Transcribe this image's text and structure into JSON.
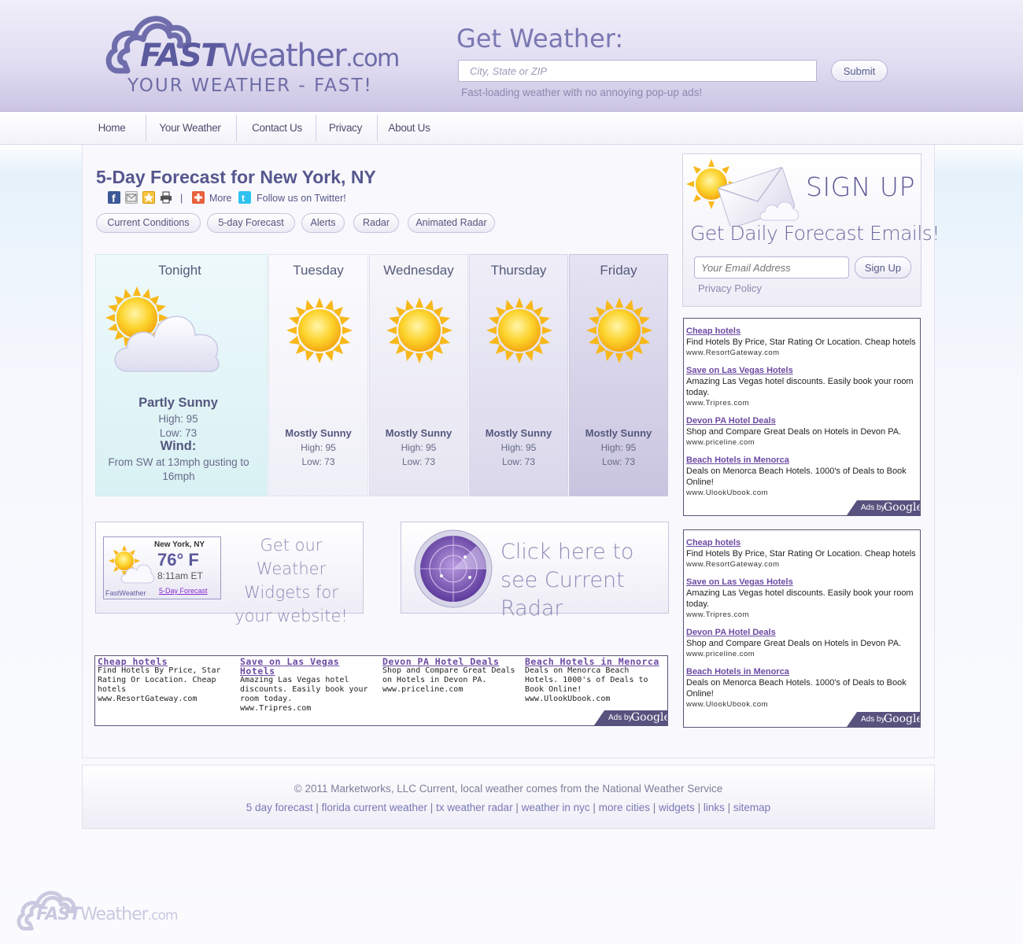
{
  "header": {
    "logo_fast": "FAST",
    "logo_weather": "Weather",
    "logo_com": ".com",
    "logo_tagline": "YOUR WEATHER - FAST!",
    "get_weather": "Get Weather:",
    "search_placeholder": "City, State or ZIP",
    "submit_label": "Submit",
    "tagline": "Fast-loading weather with no annoying pop-up ads!"
  },
  "nav": {
    "items": [
      {
        "label": "Home"
      },
      {
        "label": "Your Weather"
      },
      {
        "label": "Contact Us"
      },
      {
        "label": "Privacy"
      },
      {
        "label": "About Us"
      }
    ]
  },
  "page": {
    "title": "5-Day Forecast for New York, NY",
    "share": {
      "separator": "|",
      "more": "More",
      "twitter": "Follow us on Twitter!"
    },
    "tabs": [
      {
        "label": "Current Conditions"
      },
      {
        "label": "5-day Forecast"
      },
      {
        "label": "Alerts"
      },
      {
        "label": "Radar"
      },
      {
        "label": "Animated Radar"
      }
    ]
  },
  "forecast": {
    "tonight": {
      "day": "Tonight",
      "condition": "Partly Sunny",
      "high": "High: 95",
      "low": "Low: 73",
      "wind_label": "Wind:",
      "wind": "From SW at 13mph gusting to 16mph",
      "icon": "partly-sunny-icon"
    },
    "days": [
      {
        "day": "Tuesday",
        "condition": "Mostly Sunny",
        "high": "High: 95",
        "low": "Low: 73",
        "icon": "sun-icon"
      },
      {
        "day": "Wednesday",
        "condition": "Mostly Sunny",
        "high": "High: 95",
        "low": "Low: 73",
        "icon": "sun-icon"
      },
      {
        "day": "Thursday",
        "condition": "Mostly Sunny",
        "high": "High: 95",
        "low": "Low: 73",
        "icon": "sun-icon"
      },
      {
        "day": "Friday",
        "condition": "Mostly Sunny",
        "high": "High: 95",
        "low": "Low: 73",
        "icon": "sun-icon"
      }
    ]
  },
  "widget_promo": {
    "location": "New York, NY",
    "temp": "76° F",
    "time": "8:11am ET",
    "brand": "FastWeather",
    "link": "5-Day Forecast",
    "text": "Get our Weather Widgets for your website!"
  },
  "radar_promo": {
    "text": "Click here to see Current Radar"
  },
  "ads": {
    "items": [
      {
        "title": "Cheap hotels",
        "desc": "Find Hotels By Price, Star Rating Or Location. Cheap hotels",
        "url": "www.ResortGateway.com"
      },
      {
        "title": "Save on Las Vegas Hotels",
        "desc": "Amazing Las Vegas hotel discounts. Easily book your room today.",
        "url": "www.Tripres.com"
      },
      {
        "title": "Devon PA Hotel Deals",
        "desc": "Shop and Compare Great Deals on Hotels in Devon PA.",
        "url": "www.priceline.com"
      },
      {
        "title": "Beach Hotels in Menorca",
        "desc": "Deals on Menorca Beach Hotels. 1000's of Deals to Book Online!",
        "url": "www.UlookUbook.com"
      }
    ],
    "ads_by": "Ads by",
    "google": "Google"
  },
  "signup": {
    "title": "SIGN UP",
    "subtitle": "Get Daily Forecast Emails!",
    "email_placeholder": "Your Email Address",
    "button": "Sign Up",
    "privacy": "Privacy Policy"
  },
  "footer": {
    "copyright": "© 2011 Marketworks, LLC Current, local weather comes from the National Weather Service",
    "links": [
      {
        "label": "5 day forecast"
      },
      {
        "label": "florida current weather"
      },
      {
        "label": "tx weather radar"
      },
      {
        "label": "weather in nyc"
      },
      {
        "label": "more cities"
      },
      {
        "label": "widgets"
      },
      {
        "label": "links"
      },
      {
        "label": "sitemap"
      }
    ],
    "separator": "|"
  },
  "colors": {
    "brand": "#6c6aa9",
    "header_bg": "#e2def2",
    "ad_title": "#6c4aa3",
    "ads_badge": "#58527e"
  }
}
